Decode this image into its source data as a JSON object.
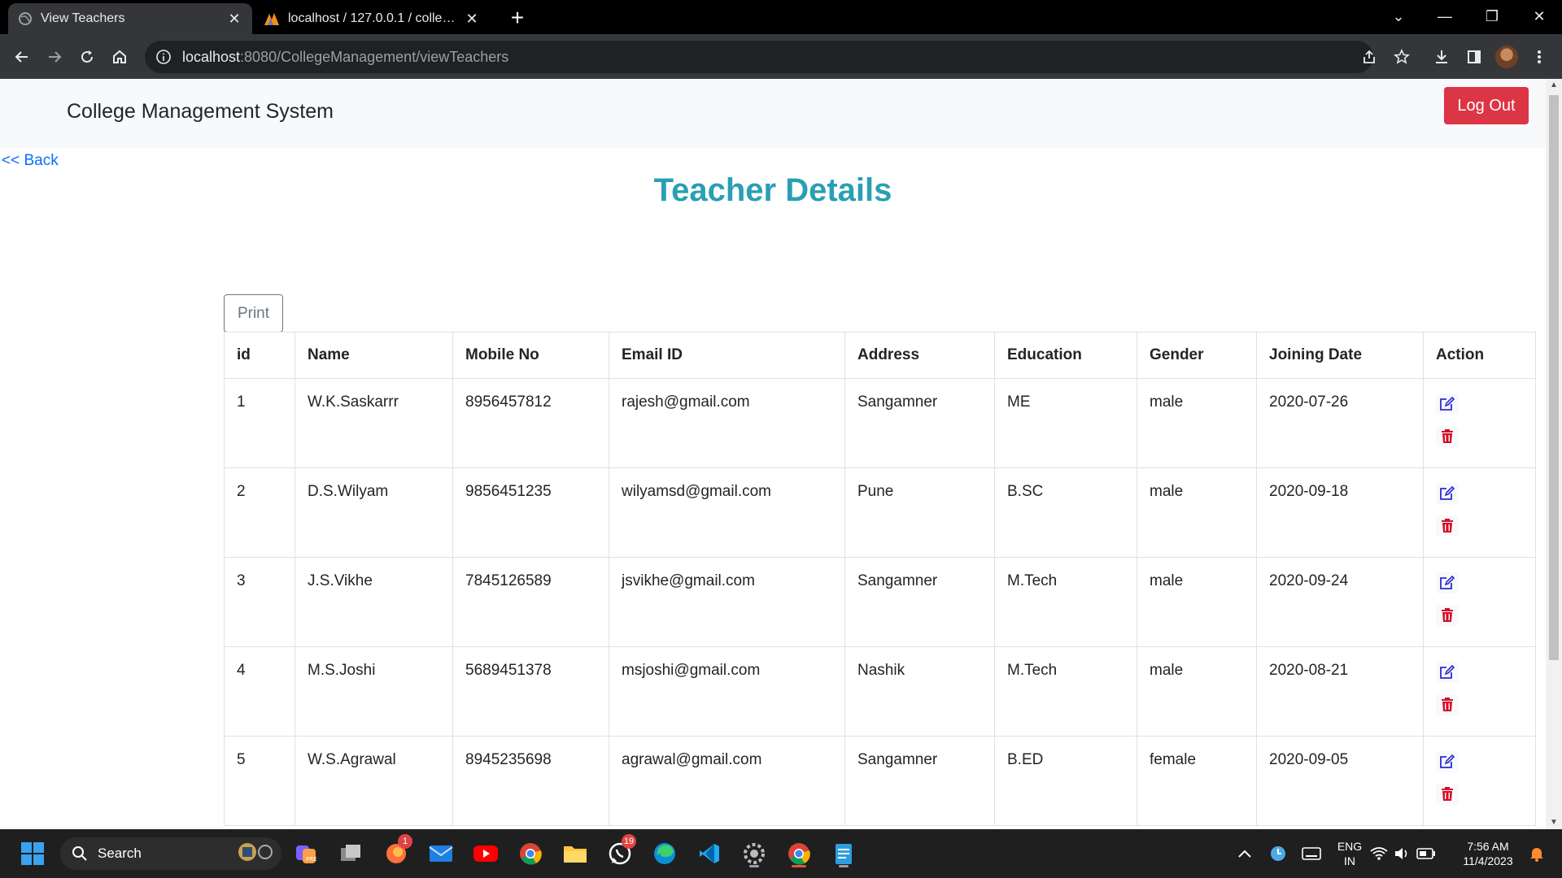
{
  "browser": {
    "tabs": [
      {
        "title": "View Teachers",
        "active": true
      },
      {
        "title": "localhost / 127.0.0.1 / collegemanagement",
        "active": false
      }
    ],
    "url_host": "localhost",
    "url_path": ":8080/CollegeManagement/viewTeachers"
  },
  "app": {
    "brand": "College Management System",
    "logout_label": "Log Out",
    "back_label": "<< Back",
    "heading": "Teacher Details",
    "print_label": "Print",
    "accent_color": "#2a9fb4",
    "danger_color": "#dc3545"
  },
  "table": {
    "headers": [
      "id",
      "Name",
      "Mobile No",
      "Email ID",
      "Address",
      "Education",
      "Gender",
      "Joining Date",
      "Action"
    ],
    "rows": [
      {
        "id": "1",
        "name": "W.K.Saskarrr",
        "mobile": "8956457812",
        "email": "rajesh@gmail.com",
        "address": "Sangamner",
        "education": "ME",
        "gender": "male",
        "joining": "2020-07-26"
      },
      {
        "id": "2",
        "name": "D.S.Wilyam",
        "mobile": "9856451235",
        "email": "wilyamsd@gmail.com",
        "address": "Pune",
        "education": "B.SC",
        "gender": "male",
        "joining": "2020-09-18"
      },
      {
        "id": "3",
        "name": "J.S.Vikhe",
        "mobile": "7845126589",
        "email": "jsvikhe@gmail.com",
        "address": "Sangamner",
        "education": "M.Tech",
        "gender": "male",
        "joining": "2020-09-24"
      },
      {
        "id": "4",
        "name": "M.S.Joshi",
        "mobile": "5689451378",
        "email": "msjoshi@gmail.com",
        "address": "Nashik",
        "education": "M.Tech",
        "gender": "male",
        "joining": "2020-08-21"
      },
      {
        "id": "5",
        "name": "W.S.Agrawal",
        "mobile": "8945235698",
        "email": "agrawal@gmail.com",
        "address": "Sangamner",
        "education": "B.ED",
        "gender": "female",
        "joining": "2020-09-05"
      }
    ],
    "action_icons": [
      "edit-icon",
      "trash-icon"
    ]
  },
  "taskbar": {
    "search_label": "Search",
    "badges": {
      "firefox": "1",
      "whatsapp": "19"
    },
    "language": "ENG",
    "region": "IN",
    "time": "7:56 AM",
    "date": "11/4/2023"
  }
}
